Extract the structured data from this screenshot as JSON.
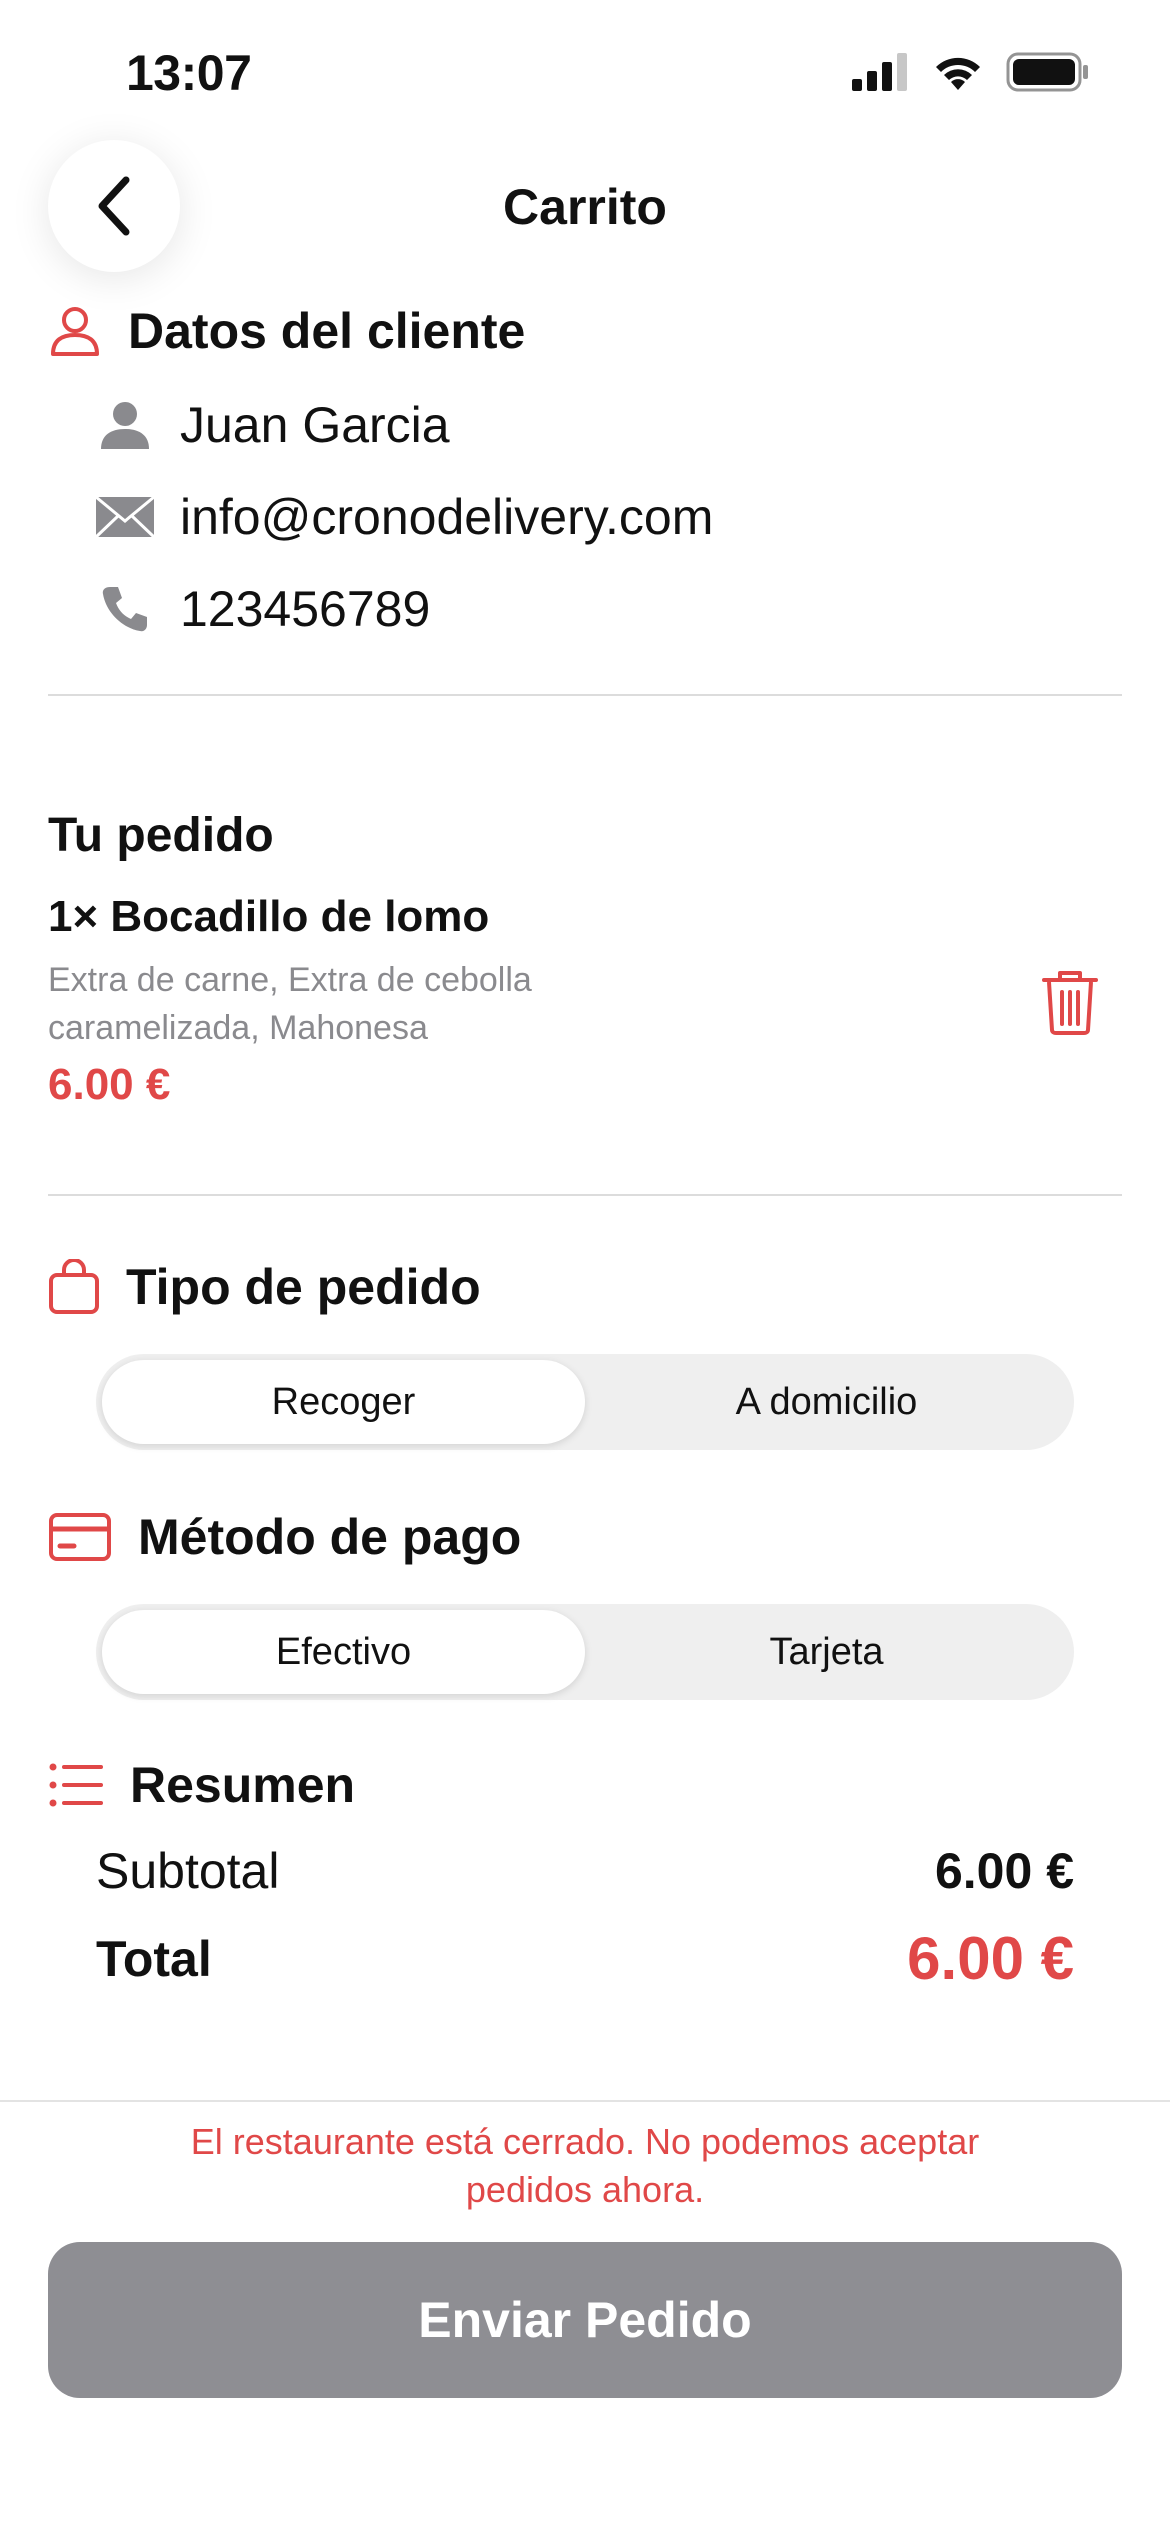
{
  "status_bar": {
    "time": "13:07",
    "icons": [
      "signal-icon",
      "wifi-icon",
      "battery-icon"
    ]
  },
  "nav": {
    "title": "Carrito",
    "back_icon": "chevron-left-icon"
  },
  "customer": {
    "heading": "Datos del cliente",
    "name": "Juan Garcia",
    "email": "info@cronodelivery.com",
    "phone": "123456789"
  },
  "order": {
    "heading": "Tu pedido",
    "items": [
      {
        "name": "1× Bocadillo de lomo",
        "extras_line1": "Extra de carne, Extra de cebolla",
        "extras_line2": "caramelizada, Mahonesa",
        "price": "6.00 €"
      }
    ]
  },
  "order_type": {
    "heading": "Tipo de pedido",
    "options": [
      "Recoger",
      "A domicilio"
    ],
    "selected": "Recoger"
  },
  "payment": {
    "heading": "Método de pago",
    "options": [
      "Efectivo",
      "Tarjeta"
    ],
    "selected": "Efectivo"
  },
  "summary": {
    "heading": "Resumen",
    "subtotal_label": "Subtotal",
    "subtotal_value": "6.00 €",
    "total_label": "Total",
    "total_value": "6.00 €"
  },
  "footer": {
    "closed_line1": "El restaurante está cerrado. No podemos aceptar",
    "closed_line2": "pedidos ahora.",
    "submit_label": "Enviar Pedido"
  },
  "colors": {
    "accent": "#e04848",
    "muted": "#8a8a8e",
    "disabled_button": "#8e8e93"
  }
}
